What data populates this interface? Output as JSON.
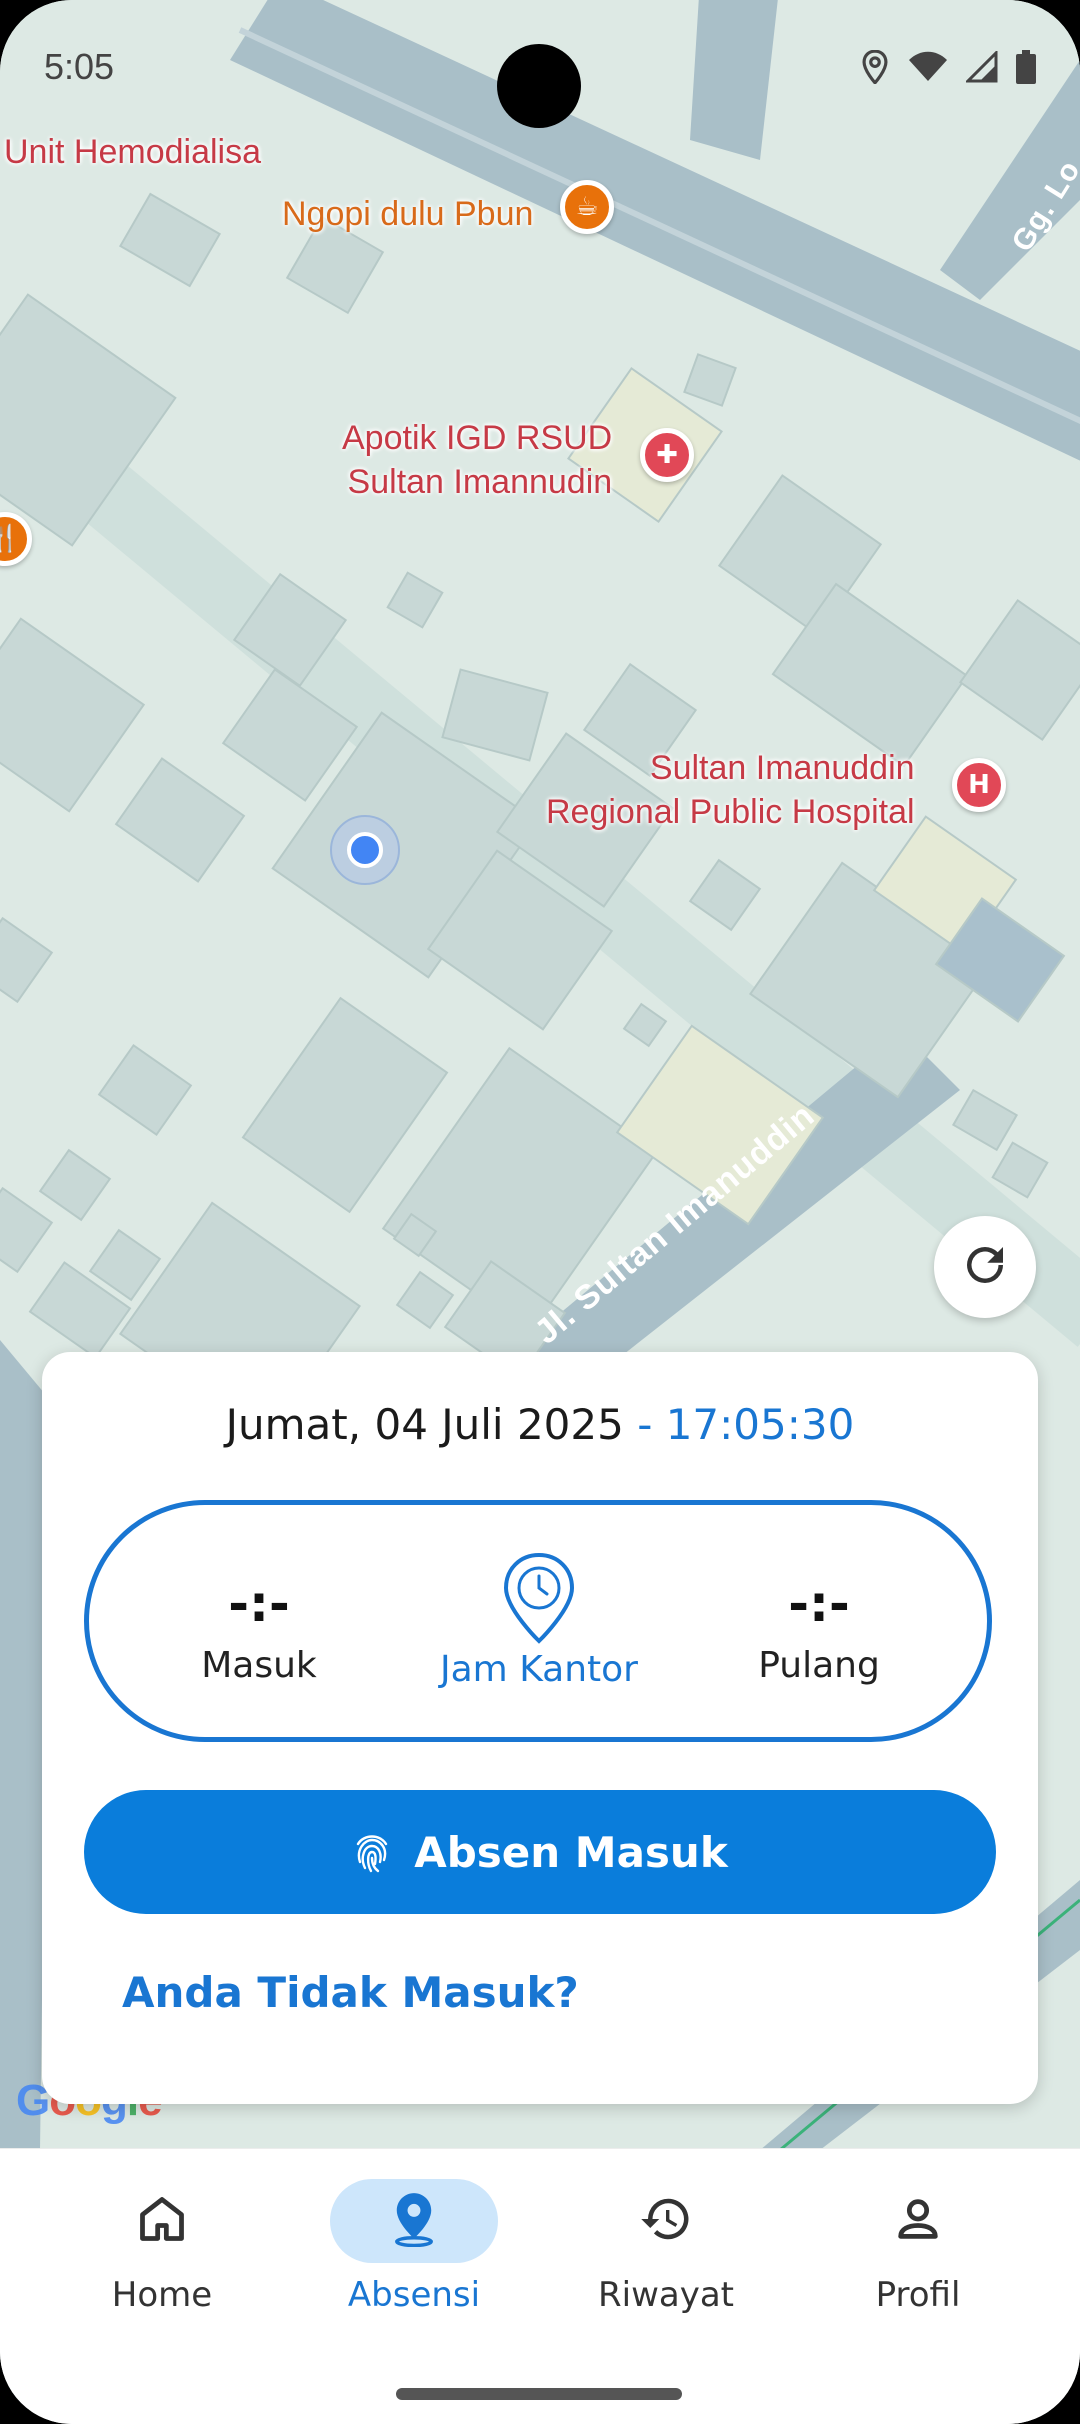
{
  "status_bar": {
    "time": "5:05",
    "icons": [
      "location-icon",
      "wifi-icon",
      "signal-icon",
      "battery-icon"
    ]
  },
  "map": {
    "pois": [
      {
        "label": "Unit Hemodialisa",
        "color": "red"
      },
      {
        "label": "Ngopi dulu Pbun",
        "color": "orange",
        "icon": "cafe-icon"
      },
      {
        "label": "Apotik IGD RSUD\nSultan Imannudin",
        "color": "red",
        "icon": "pharmacy-icon"
      },
      {
        "label": "Sultan Imanuddin\nRegional Public Hospital",
        "color": "red",
        "icon": "hospital-icon"
      }
    ],
    "roads": [
      "Jl. Sultan Imanuddin",
      "Gg. Lo"
    ],
    "google_logo": "Google"
  },
  "card": {
    "date": "Jumat, 04 Juli 2025",
    "separator": " - ",
    "time": "17:05:30",
    "check_in": {
      "value": "-:-",
      "label": "Masuk"
    },
    "office": {
      "label": "Jam Kantor"
    },
    "check_out": {
      "value": "-:-",
      "label": "Pulang"
    },
    "primary_button": "Absen Masuk",
    "secondary_link": "Anda Tidak Masuk?"
  },
  "bottom_nav": {
    "active": "Absensi",
    "items": [
      {
        "label": "Home",
        "icon": "home-icon"
      },
      {
        "label": "Absensi",
        "icon": "location-pin-icon"
      },
      {
        "label": "Riwayat",
        "icon": "history-icon"
      },
      {
        "label": "Profil",
        "icon": "person-icon"
      }
    ]
  },
  "colors": {
    "primary": "#0a7ddb",
    "accent_text": "#1976d2",
    "nav_active_bg": "#cde6fb",
    "poi_red": "#c63a46",
    "poi_orange": "#d86a1a"
  }
}
